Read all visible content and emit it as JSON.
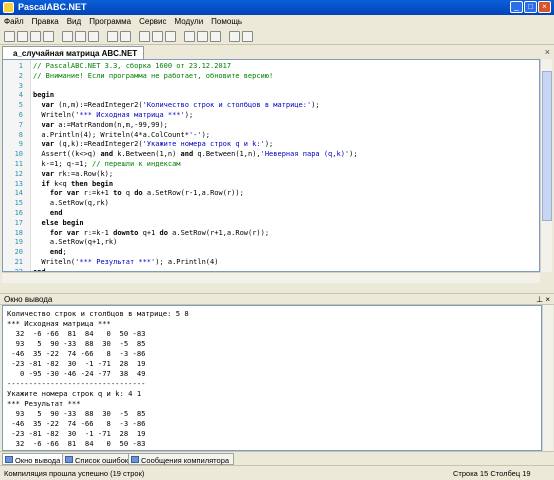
{
  "window": {
    "title": "PascalABC.NET",
    "min": "_",
    "max": "□",
    "close": "×"
  },
  "menu": [
    "Файл",
    "Правка",
    "Вид",
    "Программа",
    "Сервис",
    "Модули",
    "Помощь"
  ],
  "tab": {
    "label": "a_случайная матрица ABC.NET 3.3.pas*",
    "close": "×"
  },
  "code_lines": [
    "// PascalABC.NET 3.3, сборка 1600 от 23.12.2017",
    "// Внимание! Если программа не работает, обновите версию!",
    "",
    "begin",
    "  var (n,m):=ReadInteger2('Количество строк и столбцов в матрице:');",
    "  Writeln('*** Исходная матрица ***');",
    "  var a:=MatrRandom(n,m,-99,99);",
    "  a.Println(4); Writeln(4*a.ColCount*'-');",
    "  var (q,k):=ReadInteger2('Укажите номера строк q и k:');",
    "  Assert((k<>q) and k.Between(1,n) and q.Between(1,n),'Неверная пара (q,k)');",
    "  k-=1; q-=1; // перешли к индексам",
    "  var rk:=a.Row(k);",
    "  if k<q then begin",
    "    for var r:=k+1 to q do a.SetRow(r-1,a.Row(r));",
    "    a.SetRow(q,rk)",
    "    end",
    "  else begin",
    "    for var r:=k-1 downto q+1 do a.SetRow(r+1,a.Row(r));",
    "    a.SetRow(q+1,rk)",
    "    end;",
    "  Writeln('*** Результат ***'); a.Println(4)",
    "end."
  ],
  "output_panel": {
    "label": "Окно вывода",
    "pin": "⊥",
    "close": "×"
  },
  "output_lines": [
    "Количество строк и столбцов в матрице: 5 8",
    "*** Исходная матрица ***",
    "  32  -6 -66  81  84   0  50 -83",
    "  93   5  90 -33  88  30  -5  85",
    " -46  35 -22  74 -66   8  -3 -86",
    " -23 -81 -82  30  -1 -71  28  19",
    "   0 -95 -30 -46 -24 -77  38  49",
    "--------------------------------",
    "Укажите номера строк q и k: 4 1",
    "*** Результат ***",
    "  93   5  90 -33  88  30  -5  85",
    " -46  35 -22  74 -66   8  -3 -86",
    " -23 -81 -82  30  -1 -71  28  19",
    "  32  -6 -66  81  84   0  50 -83",
    "   0 -95 -30 -46 -24 -77  38  49"
  ],
  "bottom_tabs": [
    "Окно вывода",
    "Список ошибок",
    "Сообщения компилятора"
  ],
  "status": {
    "message": "Компиляция прошла успешно (19 строк)",
    "position": "Строка  15  Столбец  19"
  }
}
